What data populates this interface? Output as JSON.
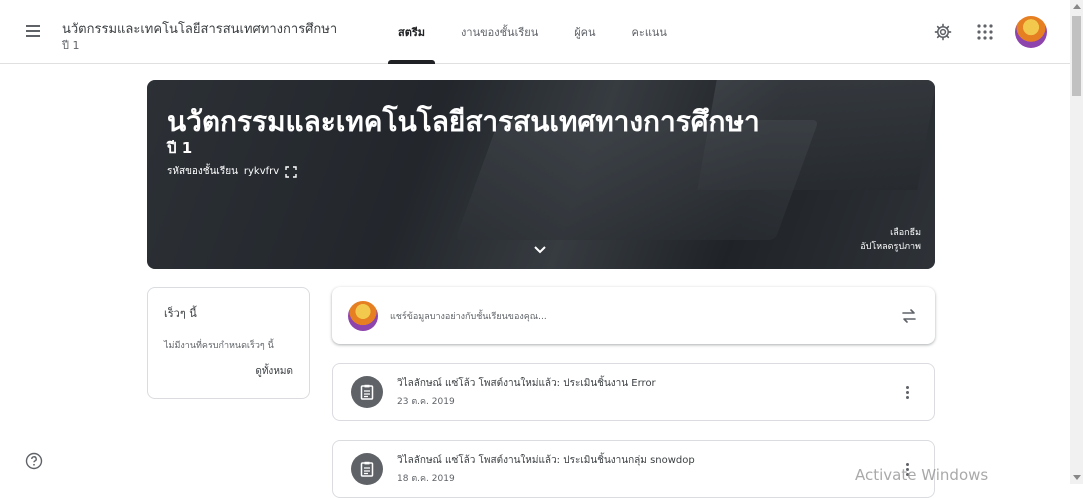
{
  "header": {
    "class_title": "นวัตกรรมและเทคโนโลยีสารสนเทศทางการศึกษา",
    "class_section": "ปี 1",
    "tabs": [
      {
        "label": "สตรีม",
        "active": true
      },
      {
        "label": "งานของชั้นเรียน",
        "active": false
      },
      {
        "label": "ผู้คน",
        "active": false
      },
      {
        "label": "คะแนน",
        "active": false
      }
    ],
    "icons": [
      "settings-icon",
      "apps-grid-icon",
      "account-avatar"
    ]
  },
  "banner": {
    "title": "นวัตกรรมและเทคโนโลยีสารสนเทศทางการศึกษา",
    "section": "ปี 1",
    "class_code_label": "รหัสของชั้นเรียน",
    "class_code": "rykvfrv",
    "select_theme": "เลือกธีม",
    "upload_photo": "อัปโหลดรูปภาพ"
  },
  "upcoming": {
    "title": "เร็วๆ นี้",
    "empty_text": "ไม่มีงานที่ครบกำหนดเร็วๆ นี้",
    "view_all": "ดูทั้งหมด"
  },
  "share": {
    "placeholder": "แชร์ข้อมูลบางอย่างกับชั้นเรียนของคุณ..."
  },
  "posts": [
    {
      "title": "วิไลลักษณ์ แซ่โล้ว โพสต์งานใหม่แล้ว: ประเมินชิ้นงาน Error",
      "date": "23 ต.ค. 2019"
    },
    {
      "title": "วิไลลักษณ์ แซ่โล้ว โพสต์งานใหม่แล้ว: ประเมินชิ้นงานกลุ่ม snowdop",
      "date": "18 ต.ค. 2019"
    }
  ],
  "watermark": "Activate Windows",
  "colors": {
    "accent": "#202124",
    "banner": "#2f3439",
    "border": "#dadce0",
    "icon_bg": "#5f6368"
  }
}
